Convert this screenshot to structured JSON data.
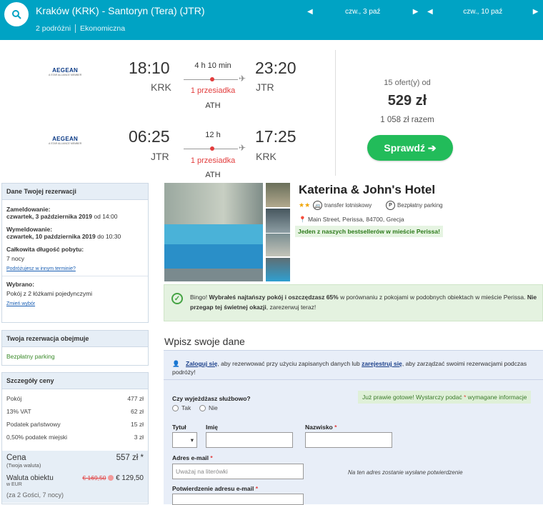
{
  "search": {
    "route": "Kraków (KRK) - Santoryn (Tera) (JTR)",
    "travellers": "2 podróżni",
    "cabin": "Ekonomiczna",
    "depart_date": "czw., 3 paź",
    "return_date": "czw., 10 paź"
  },
  "flights": [
    {
      "airline": "AEGEAN",
      "alliance": "A STAR ALLIANCE MEMBER",
      "dep_time": "18:10",
      "dep_code": "KRK",
      "duration": "4 h 10 min",
      "stops": "1 przesiadka",
      "via": "ATH",
      "arr_time": "23:20",
      "arr_code": "JTR"
    },
    {
      "airline": "AEGEAN",
      "alliance": "A STAR ALLIANCE MEMBER",
      "dep_time": "06:25",
      "dep_code": "JTR",
      "duration": "12 h",
      "stops": "1 przesiadka",
      "via": "ATH",
      "arr_time": "17:25",
      "arr_code": "KRK"
    }
  ],
  "offer": {
    "count": "15 ofert(y) od",
    "price": "529 zł",
    "total": "1 058 zł razem",
    "button": "Sprawdź ➔"
  },
  "reservation": {
    "header": "Dane Twojej rezerwacji",
    "checkin_label": "Zameldowanie:",
    "checkin_date": "czwartek, 3 października 2019",
    "checkin_time": " od 14:00",
    "checkout_label": "Wymeldowanie:",
    "checkout_date": "czwartek, 10 października 2019",
    "checkout_time": " do 10:30",
    "length_label": "Całkowita długość pobytu:",
    "length_value": "7 nocy",
    "change_dates": "Podróżujesz w innym terminie?",
    "selected_label": "Wybrano:",
    "selected_value": "Pokój z 2 łóżkami pojedynczymi",
    "change_selection": "Zmień wybór"
  },
  "includes": {
    "header": "Twoja rezerwacja obejmuje",
    "item": "Bezpłatny parking"
  },
  "price_details": {
    "header": "Szczegóły ceny",
    "rows": [
      {
        "label": "Pokój",
        "value": "477 zł"
      },
      {
        "label": "13% VAT",
        "value": "62 zł"
      },
      {
        "label": "Podatek państwowy",
        "value": "15 zł"
      },
      {
        "label": "0,50% podatek miejski",
        "value": "3 zł"
      }
    ],
    "total_label": "Cena",
    "total_sub": "(Twoja waluta)",
    "total_value": "557 zł *",
    "local_label": "Waluta obiektu",
    "local_sub": "w EUR",
    "local_old": "€ 169,50",
    "local_new": "€ 129,50",
    "guests": "(za 2 Gości, 7 nocy)"
  },
  "hotel": {
    "name": "Katerina & John's Hotel",
    "stars": "★★",
    "feature_transfer": "transfer lotniskowy",
    "feature_parking": "Bezpłatny parking",
    "address": "Main Street, Perissa, 84700, Grecja",
    "bestseller": "Jeden z naszych bestsellerów w mieście Perissa!"
  },
  "bingo": {
    "prefix": "Bingo! ",
    "bold1": "Wybrałeś najtańszy pokój i oszczędzasz 65%",
    "middle": " w porównaniu z pokojami w podobnych obiektach w mieście Perissa. ",
    "bold2": "Nie przegap tej świetnej okazji",
    "suffix": ", zarezerwuj teraz!"
  },
  "form": {
    "title": "Wpisz swoje dane",
    "login_link": "Zaloguj się",
    "login_mid": ", aby rezerwować przy użyciu zapisanych danych lub ",
    "register_link": "zarejestruj się",
    "login_end": ", aby zarządzać swoimi rezerwacjami podczas podróży!",
    "ready_text": "Już prawie gotowe! Wystarczy podać ",
    "ready_star": "*",
    "ready_end": " wymagane informacje",
    "business_q": "Czy wyjeżdżasz służbowo?",
    "yes": "Tak",
    "no": "Nie",
    "title_label": "Tytuł",
    "first_label": "Imię",
    "last_label": "Nazwisko",
    "star": "*",
    "email_label": "Adres e-mail",
    "email_placeholder": "Uważaj na literówki",
    "email_note": "Na ten adres zostanie wysłane potwierdzenie",
    "confirm_label": "Potwierdzenie adresu e-mail"
  },
  "colors": {
    "brand": "#00a3c4",
    "cta": "#22bc5a",
    "alert": "#e23d3d"
  }
}
